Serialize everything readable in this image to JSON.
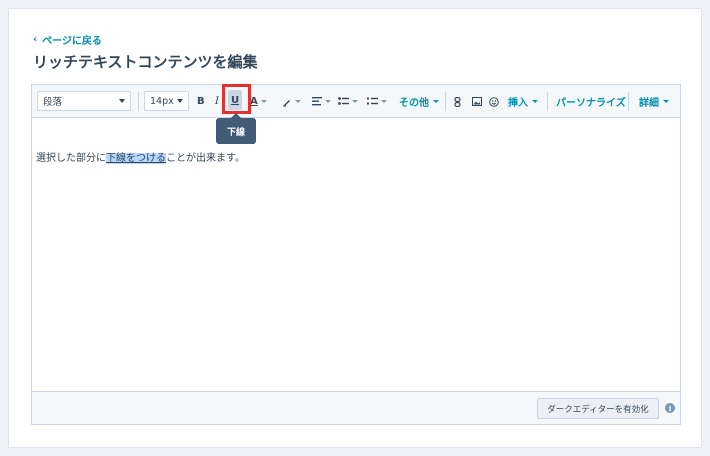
{
  "nav": {
    "back_label": "ページに戻る",
    "back_chevron": "‹"
  },
  "page": {
    "title": "リッチテキストコンテンツを編集"
  },
  "toolbar": {
    "paragraph_value": "段落",
    "font_size_value": "14px",
    "bold_label": "B",
    "italic_label": "I",
    "underline_label": "U",
    "text_color_label": "A",
    "other_label": "その他",
    "insert_label": "挿入",
    "personalize_label": "パーソナライズ",
    "details_label": "詳細",
    "underline_active": true
  },
  "tooltip": {
    "label": "下線"
  },
  "content": {
    "before": "選択した部分に",
    "selected": "下線をつける",
    "after": "ことが出来ます。"
  },
  "footer": {
    "dark_editor_label": "ダークエディターを有効化",
    "info_icon": "i"
  },
  "colors": {
    "accent": "#0091ae",
    "highlight": "#e5312b",
    "tooltip_bg": "#425b76",
    "selection": "#b4d5fe"
  }
}
